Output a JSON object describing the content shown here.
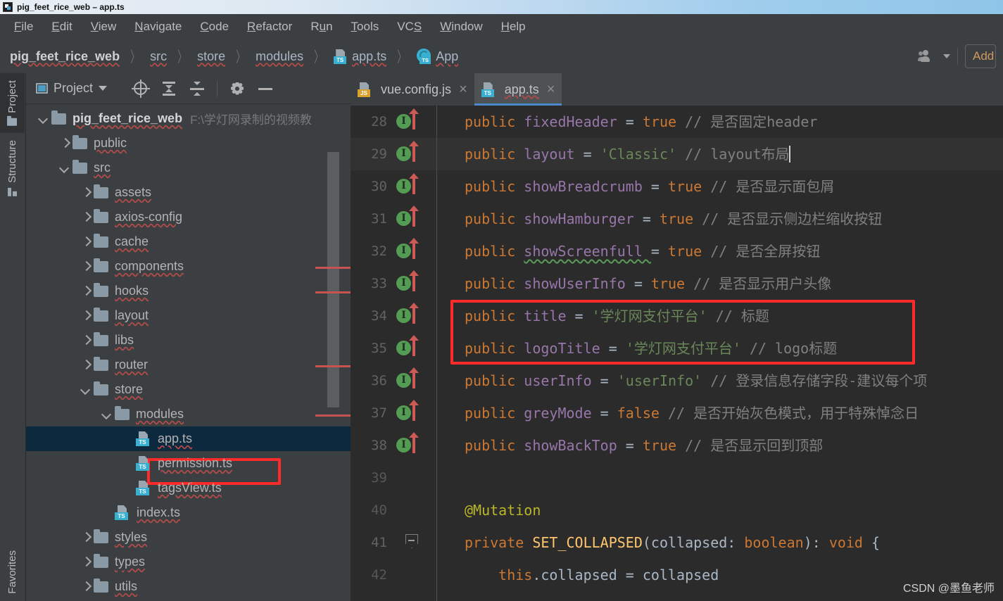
{
  "titlebar": {
    "text": "pig_feet_rice_web – app.ts",
    "icon": "idea-app-icon"
  },
  "menubar": {
    "items": [
      {
        "label": "File",
        "mnemonic": "F"
      },
      {
        "label": "Edit",
        "mnemonic": "E"
      },
      {
        "label": "View",
        "mnemonic": "V"
      },
      {
        "label": "Navigate",
        "mnemonic": "N"
      },
      {
        "label": "Code",
        "mnemonic": "C"
      },
      {
        "label": "Refactor",
        "mnemonic": "R"
      },
      {
        "label": "Run",
        "mnemonic": "u"
      },
      {
        "label": "Tools",
        "mnemonic": "T"
      },
      {
        "label": "VCS",
        "mnemonic": "S"
      },
      {
        "label": "Window",
        "mnemonic": "W"
      },
      {
        "label": "Help",
        "mnemonic": "H"
      }
    ]
  },
  "breadcrumb": {
    "separator": "〉",
    "items": [
      {
        "label": "pig_feet_rice_web",
        "icon": "none",
        "root": true
      },
      {
        "label": "src",
        "icon": "none"
      },
      {
        "label": "store",
        "icon": "none"
      },
      {
        "label": "modules",
        "icon": "none"
      },
      {
        "label": "app.ts",
        "icon": "ts-file-icon"
      },
      {
        "label": "App",
        "icon": "ts-class-icon"
      }
    ]
  },
  "navbar_right": {
    "people_icon": "people-icon",
    "dropdown_icon": "chevron-down-icon",
    "run_config_label": "Add Configuration..."
  },
  "toolstrip": {
    "top": [
      {
        "label": "Project",
        "icon": "folder-icon",
        "active": true
      },
      {
        "label": "Structure",
        "icon": "structure-icon",
        "active": false
      }
    ],
    "bottom": [
      {
        "label": "Favorites",
        "icon": "none",
        "active": false
      }
    ]
  },
  "project_panel": {
    "title": "Project",
    "dropdown_icon": "chevron-down-icon",
    "tools": [
      {
        "name": "locate-icon",
        "title": "Select Opened File"
      },
      {
        "name": "expand-all-icon",
        "title": "Expand All"
      },
      {
        "name": "collapse-all-icon",
        "title": "Collapse All"
      },
      {
        "name": "gear-icon",
        "title": "Settings"
      },
      {
        "name": "minimize-icon",
        "title": "Hide"
      }
    ],
    "tree": [
      {
        "label": "pig_feet_rice_web",
        "path": "F:\\学灯网录制的视频教",
        "depth": 0,
        "type": "folder",
        "state": "expanded",
        "bold": true,
        "selected": false
      },
      {
        "label": "public",
        "path": "",
        "depth": 1,
        "type": "folder",
        "state": "collapsed",
        "bold": false,
        "selected": false
      },
      {
        "label": "src",
        "path": "",
        "depth": 1,
        "type": "folder",
        "state": "expanded",
        "bold": false,
        "selected": false
      },
      {
        "label": "assets",
        "path": "",
        "depth": 2,
        "type": "folder",
        "state": "collapsed",
        "bold": false,
        "selected": false
      },
      {
        "label": "axios-config",
        "path": "",
        "depth": 2,
        "type": "folder",
        "state": "collapsed",
        "bold": false,
        "selected": false
      },
      {
        "label": "cache",
        "path": "",
        "depth": 2,
        "type": "folder",
        "state": "collapsed",
        "bold": false,
        "selected": false
      },
      {
        "label": "components",
        "path": "",
        "depth": 2,
        "type": "folder",
        "state": "collapsed",
        "bold": false,
        "selected": false
      },
      {
        "label": "hooks",
        "path": "",
        "depth": 2,
        "type": "folder",
        "state": "collapsed",
        "bold": false,
        "selected": false
      },
      {
        "label": "layout",
        "path": "",
        "depth": 2,
        "type": "folder",
        "state": "collapsed",
        "bold": false,
        "selected": false
      },
      {
        "label": "libs",
        "path": "",
        "depth": 2,
        "type": "folder",
        "state": "collapsed",
        "bold": false,
        "selected": false
      },
      {
        "label": "router",
        "path": "",
        "depth": 2,
        "type": "folder",
        "state": "collapsed",
        "bold": false,
        "selected": false
      },
      {
        "label": "store",
        "path": "",
        "depth": 2,
        "type": "folder",
        "state": "expanded",
        "bold": false,
        "selected": false
      },
      {
        "label": "modules",
        "path": "",
        "depth": 3,
        "type": "folder",
        "state": "expanded",
        "bold": false,
        "selected": false
      },
      {
        "label": "app.ts",
        "path": "",
        "depth": 4,
        "type": "ts",
        "state": "none",
        "bold": false,
        "selected": true
      },
      {
        "label": "permission.ts",
        "path": "",
        "depth": 4,
        "type": "ts",
        "state": "none",
        "bold": false,
        "selected": false
      },
      {
        "label": "tagsView.ts",
        "path": "",
        "depth": 4,
        "type": "ts",
        "state": "none",
        "bold": false,
        "selected": false
      },
      {
        "label": "index.ts",
        "path": "",
        "depth": 3,
        "type": "ts",
        "state": "none",
        "bold": false,
        "selected": false
      },
      {
        "label": "styles",
        "path": "",
        "depth": 2,
        "type": "folder",
        "state": "collapsed",
        "bold": false,
        "selected": false
      },
      {
        "label": "types",
        "path": "",
        "depth": 2,
        "type": "folder",
        "state": "collapsed",
        "bold": false,
        "selected": false
      },
      {
        "label": "utils",
        "path": "",
        "depth": 2,
        "type": "folder",
        "state": "collapsed",
        "bold": false,
        "selected": false
      }
    ]
  },
  "editor": {
    "tabs": [
      {
        "label": "vue.config.js",
        "icon": "js-file-icon",
        "active": false,
        "close_icon": "×"
      },
      {
        "label": "app.ts",
        "icon": "ts-file-icon",
        "active": true,
        "close_icon": "×"
      }
    ],
    "lines": [
      {
        "num": "28",
        "marker": "impl-up",
        "caret": false,
        "tokens": [
          {
            "t": "public ",
            "c": "kw"
          },
          {
            "t": "fixedHeader ",
            "c": "fld"
          },
          {
            "t": "= ",
            "c": "op"
          },
          {
            "t": "true ",
            "c": "kw"
          },
          {
            "t": "// 是否固定header",
            "c": "cmt"
          }
        ]
      },
      {
        "num": "29",
        "marker": "impl-up",
        "caret": true,
        "tokens": [
          {
            "t": "public ",
            "c": "kw"
          },
          {
            "t": "layout ",
            "c": "fld"
          },
          {
            "t": "= ",
            "c": "op"
          },
          {
            "t": "'Classic' ",
            "c": "str"
          },
          {
            "t": "// layout布局",
            "c": "cmt"
          }
        ]
      },
      {
        "num": "30",
        "marker": "impl-up",
        "caret": false,
        "tokens": [
          {
            "t": "public ",
            "c": "kw"
          },
          {
            "t": "showBreadcrumb ",
            "c": "fld"
          },
          {
            "t": "= ",
            "c": "op"
          },
          {
            "t": "true ",
            "c": "kw"
          },
          {
            "t": "// 是否显示面包屑",
            "c": "cmt"
          }
        ]
      },
      {
        "num": "31",
        "marker": "impl-up",
        "caret": false,
        "tokens": [
          {
            "t": "public ",
            "c": "kw"
          },
          {
            "t": "showHamburger ",
            "c": "fld"
          },
          {
            "t": "= ",
            "c": "op"
          },
          {
            "t": "true ",
            "c": "kw"
          },
          {
            "t": "// 是否显示侧边栏缩收按钮",
            "c": "cmt"
          }
        ]
      },
      {
        "num": "32",
        "marker": "impl-up",
        "caret": false,
        "tokens": [
          {
            "t": "public ",
            "c": "kw"
          },
          {
            "t": "showScreenfull ",
            "c": "fld wavy-grn"
          },
          {
            "t": "= ",
            "c": "op"
          },
          {
            "t": "true ",
            "c": "kw"
          },
          {
            "t": "// 是否全屏按钮",
            "c": "cmt"
          }
        ]
      },
      {
        "num": "33",
        "marker": "impl-up",
        "caret": false,
        "tokens": [
          {
            "t": "public ",
            "c": "kw"
          },
          {
            "t": "showUserInfo ",
            "c": "fld"
          },
          {
            "t": "= ",
            "c": "op"
          },
          {
            "t": "true ",
            "c": "kw"
          },
          {
            "t": "// 是否显示用户头像",
            "c": "cmt"
          }
        ]
      },
      {
        "num": "34",
        "marker": "impl-up",
        "caret": false,
        "highlighted": true,
        "tokens": [
          {
            "t": "public ",
            "c": "kw"
          },
          {
            "t": "title ",
            "c": "fld"
          },
          {
            "t": "= ",
            "c": "op"
          },
          {
            "t": "'学灯网支付平台' ",
            "c": "str"
          },
          {
            "t": "// 标题",
            "c": "cmt"
          }
        ]
      },
      {
        "num": "35",
        "marker": "impl-up",
        "caret": false,
        "highlighted": true,
        "tokens": [
          {
            "t": "public ",
            "c": "kw"
          },
          {
            "t": "logoTitle ",
            "c": "fld"
          },
          {
            "t": "= ",
            "c": "op"
          },
          {
            "t": "'学灯网支付平台' ",
            "c": "str"
          },
          {
            "t": "// logo标题",
            "c": "cmt"
          }
        ]
      },
      {
        "num": "36",
        "marker": "impl-up",
        "caret": false,
        "tokens": [
          {
            "t": "public ",
            "c": "kw"
          },
          {
            "t": "userInfo ",
            "c": "fld"
          },
          {
            "t": "= ",
            "c": "op"
          },
          {
            "t": "'userInfo' ",
            "c": "str"
          },
          {
            "t": "// 登录信息存储字段-建议每个项",
            "c": "cmt"
          }
        ]
      },
      {
        "num": "37",
        "marker": "impl-up",
        "caret": false,
        "tokens": [
          {
            "t": "public ",
            "c": "kw"
          },
          {
            "t": "greyMode ",
            "c": "fld"
          },
          {
            "t": "= ",
            "c": "op"
          },
          {
            "t": "false ",
            "c": "kw"
          },
          {
            "t": "// 是否开始灰色模式，用于特殊悼念日",
            "c": "cmt"
          }
        ]
      },
      {
        "num": "38",
        "marker": "impl-up",
        "caret": false,
        "tokens": [
          {
            "t": "public ",
            "c": "kw"
          },
          {
            "t": "showBackTop ",
            "c": "fld"
          },
          {
            "t": "= ",
            "c": "op"
          },
          {
            "t": "true ",
            "c": "kw"
          },
          {
            "t": "// 是否显示回到顶部",
            "c": "cmt"
          }
        ]
      },
      {
        "num": "39",
        "marker": "none",
        "caret": false,
        "tokens": []
      },
      {
        "num": "40",
        "marker": "none",
        "caret": false,
        "tokens": [
          {
            "t": "@Mutation",
            "c": "ann"
          }
        ]
      },
      {
        "num": "41",
        "marker": "fold",
        "caret": false,
        "tokens": [
          {
            "t": "private ",
            "c": "kw"
          },
          {
            "t": "SET_COLLAPSED",
            "c": "mth"
          },
          {
            "t": "(",
            "c": "op"
          },
          {
            "t": "collapsed",
            "c": "pln"
          },
          {
            "t": ": ",
            "c": "op"
          },
          {
            "t": "boolean",
            "c": "kw"
          },
          {
            "t": "): ",
            "c": "op"
          },
          {
            "t": "void ",
            "c": "kw"
          },
          {
            "t": "{",
            "c": "op"
          }
        ]
      },
      {
        "num": "42",
        "marker": "none",
        "caret": false,
        "tokens": [
          {
            "t": "    this",
            "c": "kw"
          },
          {
            "t": ".collapsed ",
            "c": "pln"
          },
          {
            "t": "= ",
            "c": "op"
          },
          {
            "t": "collapsed",
            "c": "pln"
          }
        ]
      }
    ],
    "watermark": "CSDN @墨鱼老师"
  },
  "colors": {
    "accent_blue": "#4a88c7",
    "highlight_red": "#ff2b2b",
    "selection_navy": "#0d293e",
    "editor_bg": "#2b2b2b",
    "panel_bg": "#3c3f41",
    "ts_badge": "#39b0d2",
    "js_badge": "#d9a22e"
  }
}
